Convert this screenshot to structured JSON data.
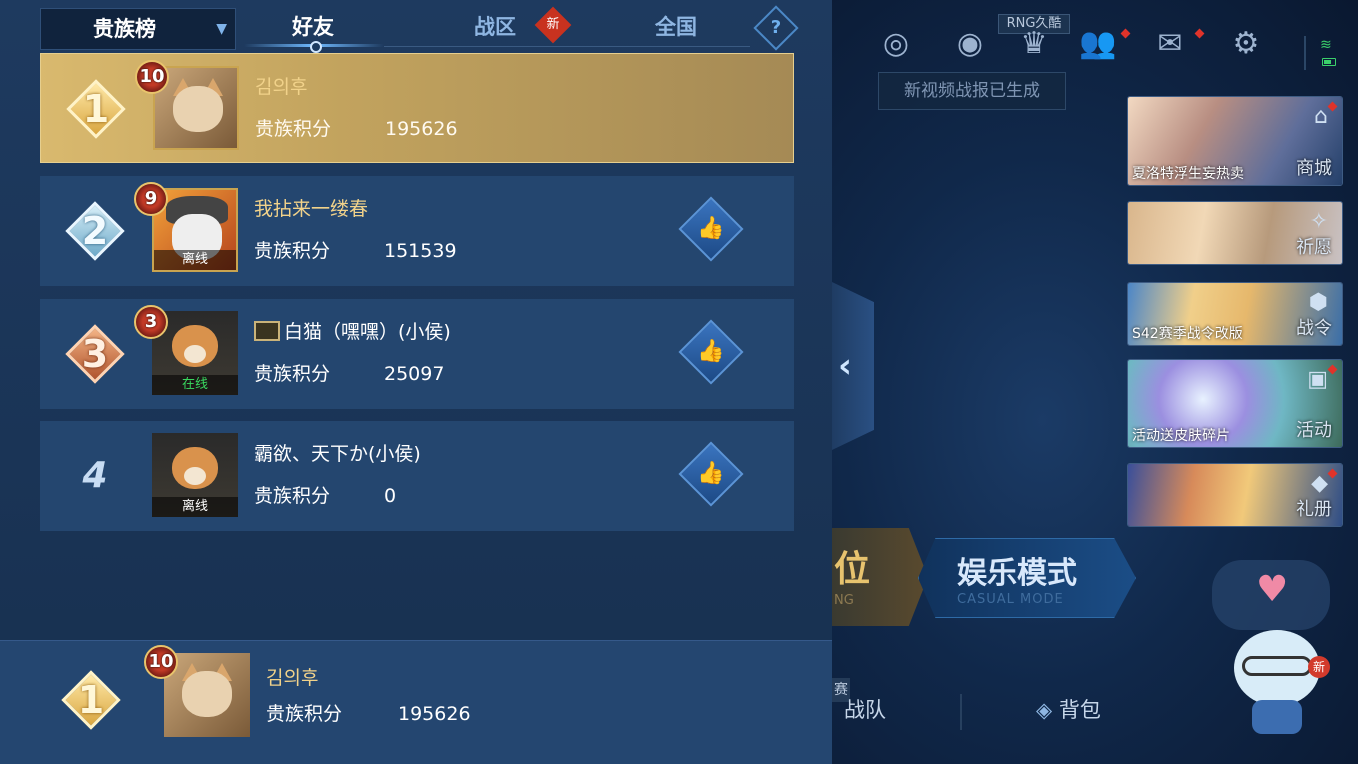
{
  "leaderboard": {
    "selector_label": "贵族榜",
    "tabs": [
      {
        "label": "好友",
        "active": true
      },
      {
        "label": "战区",
        "badge": "新"
      },
      {
        "label": "全国"
      }
    ],
    "help_glyph": "?",
    "score_label": "贵族积分",
    "rows": [
      {
        "rank": "1",
        "level": "10",
        "name": "김의후",
        "score": "195626",
        "status": ""
      },
      {
        "rank": "2",
        "level": "9",
        "name": "我拈来一缕春",
        "score": "151539",
        "status": "离线"
      },
      {
        "rank": "3",
        "level": "3",
        "name": "白猫（嘿嘿）(小侯)",
        "score": "25097",
        "status": "在线"
      },
      {
        "rank": "4",
        "level": "",
        "name": "霸欲、天下か(小侯)",
        "score": "0",
        "status": "离线"
      }
    ],
    "me": {
      "rank": "1",
      "level": "10",
      "name": "김의후",
      "score": "195626"
    }
  },
  "lobby": {
    "rng_tag": "RNG久酷",
    "toast": "新视频战报已生成",
    "side_cards": [
      {
        "caption": "夏洛特浮生妄热卖",
        "label": "商城"
      },
      {
        "caption": "",
        "label": "祈愿"
      },
      {
        "caption": "S42赛季战令改版",
        "label": "战令"
      },
      {
        "caption": "活动送皮肤碎片",
        "label": "活动"
      },
      {
        "caption": "",
        "label": "礼册"
      }
    ],
    "mode_ranked_big": "位",
    "mode_ranked_sub": "NG",
    "mode_casual_big": "娱乐模式",
    "mode_casual_sub": "CASUAL MODE",
    "nav_badge": "赛",
    "nav": [
      {
        "label": "战队"
      },
      {
        "label": "背包"
      }
    ],
    "mascot_badge": "新"
  },
  "colors": {
    "accent_gold": "#f1d28a",
    "online_green": "#39d95f",
    "alert_red": "#e0332a"
  },
  "icons": [
    "chevron-down-icon",
    "question-icon",
    "thumbs-up-icon",
    "collapse-arrow-icon",
    "target-icon",
    "eye-icon",
    "trophy-icon",
    "friends-icon",
    "mail-icon",
    "gear-icon",
    "wifi-icon",
    "battery-icon",
    "heart-icon"
  ]
}
